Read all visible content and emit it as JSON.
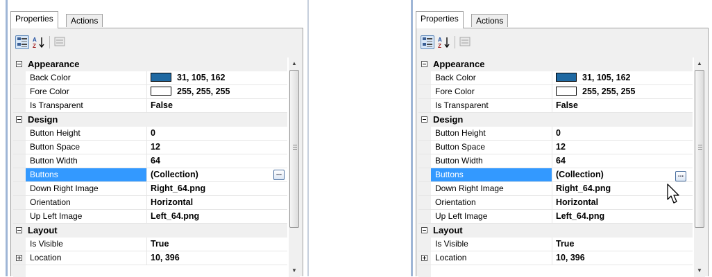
{
  "tabs": [
    {
      "label": "Properties",
      "active": true
    },
    {
      "label": "Actions",
      "active": false
    }
  ],
  "toolbar": {
    "categorized_icon": "categorized-view-icon",
    "alphabetical_icon": "alphabetical-sort-icon",
    "property_pages_icon": "property-pages-icon"
  },
  "categories": {
    "appearance": "Appearance",
    "design": "Design",
    "layout": "Layout"
  },
  "properties": {
    "back_color": {
      "name": "Back Color",
      "value": "31, 105, 162",
      "swatch": "#1f69a2"
    },
    "fore_color": {
      "name": "Fore Color",
      "value": "255, 255, 255",
      "swatch": "#ffffff"
    },
    "is_transparent": {
      "name": "Is Transparent",
      "value": "False"
    },
    "button_height": {
      "name": "Button Height",
      "value": "0"
    },
    "button_space": {
      "name": "Button Space",
      "value": "12"
    },
    "button_width": {
      "name": "Button Width",
      "value": "64"
    },
    "buttons": {
      "name": "Buttons",
      "value": "(Collection)",
      "ellipsis": "..."
    },
    "down_right_image": {
      "name": "Down Right Image",
      "value": "Right_64.png"
    },
    "orientation": {
      "name": "Orientation",
      "value": "Horizontal"
    },
    "up_left_image": {
      "name": "Up Left Image",
      "value": "Left_64.png"
    },
    "is_visible": {
      "name": "Is Visible",
      "value": "True"
    },
    "location": {
      "name": "Location",
      "value": "10, 396"
    }
  },
  "colors": {
    "selection": "#3399ff",
    "accent": "#1f69a2"
  },
  "cursor_icon": "mouse-pointer-icon"
}
